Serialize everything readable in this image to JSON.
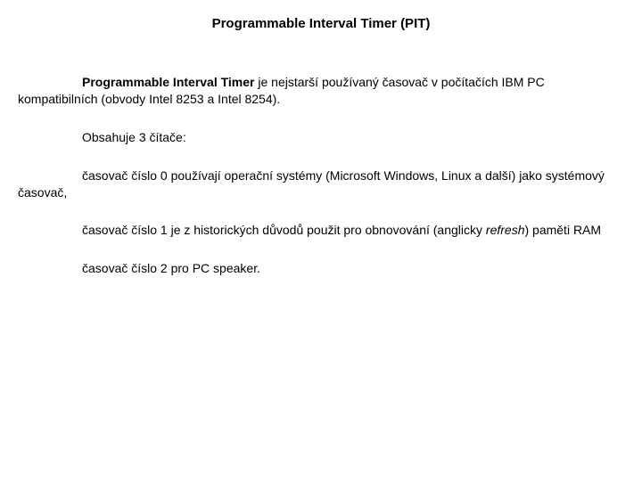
{
  "title": "Programmable Interval Timer (PIT)",
  "intro": {
    "bold": "Programmable Interval Timer",
    "rest": " je nejstarší používaný časovač v počítačích IBM PC kompatibilních (obvody Intel 8253 a Intel 8254)."
  },
  "p2": "Obsahuje 3 čítače:",
  "p3": "časovač číslo 0 používají operační systémy (Microsoft Windows, Linux a další) jako systémový časovač,",
  "p4": {
    "before": "časovač číslo 1 je z historických důvodů použit pro obnovování (anglicky ",
    "italic": "refresh",
    "after": ") paměti RAM"
  },
  "p5": "časovač číslo 2 pro PC speaker."
}
